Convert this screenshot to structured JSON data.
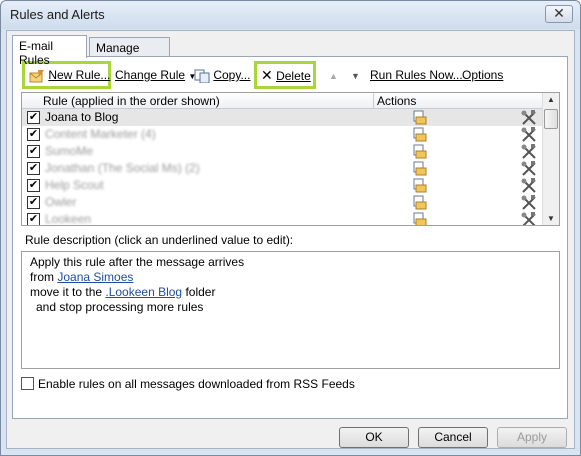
{
  "window": {
    "title": "Rules and Alerts"
  },
  "tabs": [
    {
      "label": "E-mail Rules",
      "active": true
    },
    {
      "label": "Manage Alerts",
      "active": false
    }
  ],
  "toolbar": {
    "new_rule": "New Rule...",
    "change_rule": "Change Rule",
    "copy": "Copy...",
    "delete": "Delete",
    "run_rules_now": "Run Rules Now...",
    "options": "Options"
  },
  "rules_table": {
    "columns": [
      "Rule (applied in the order shown)",
      "Actions"
    ],
    "rows": [
      {
        "name": "Joana to Blog",
        "checked": true,
        "selected": true,
        "blurred": false
      },
      {
        "name": "Content Marketer (4)",
        "checked": true,
        "selected": false,
        "blurred": true
      },
      {
        "name": "SumoMe",
        "checked": true,
        "selected": false,
        "blurred": true
      },
      {
        "name": "Jonathan (The Social Ms) (2)",
        "checked": true,
        "selected": false,
        "blurred": true
      },
      {
        "name": "Help Scout",
        "checked": true,
        "selected": false,
        "blurred": true
      },
      {
        "name": "Owler",
        "checked": true,
        "selected": false,
        "blurred": true
      },
      {
        "name": "Lookeen",
        "checked": true,
        "selected": false,
        "blurred": true
      }
    ]
  },
  "description": {
    "label": "Rule description (click an underlined value to edit):",
    "line1": "Apply this rule after the message arrives",
    "line2_prefix": "from ",
    "line2_link": "Joana Simoes",
    "line3_prefix": "move it to the ",
    "line3_link": ".Lookeen Blog",
    "line3_suffix": " folder",
    "line4": "and stop processing more rules"
  },
  "rss_option": {
    "label": "Enable rules on all messages downloaded from RSS Feeds",
    "checked": false
  },
  "buttons": {
    "ok": "OK",
    "cancel": "Cancel",
    "apply": "Apply"
  },
  "colors": {
    "highlight": "#a9d63b",
    "link": "#1f4fa0",
    "title_bar": "#d8e4f2"
  },
  "icons": [
    "new-rule-icon",
    "copy-icon",
    "delete-icon",
    "move-up-icon",
    "move-down-icon",
    "close-icon"
  ]
}
